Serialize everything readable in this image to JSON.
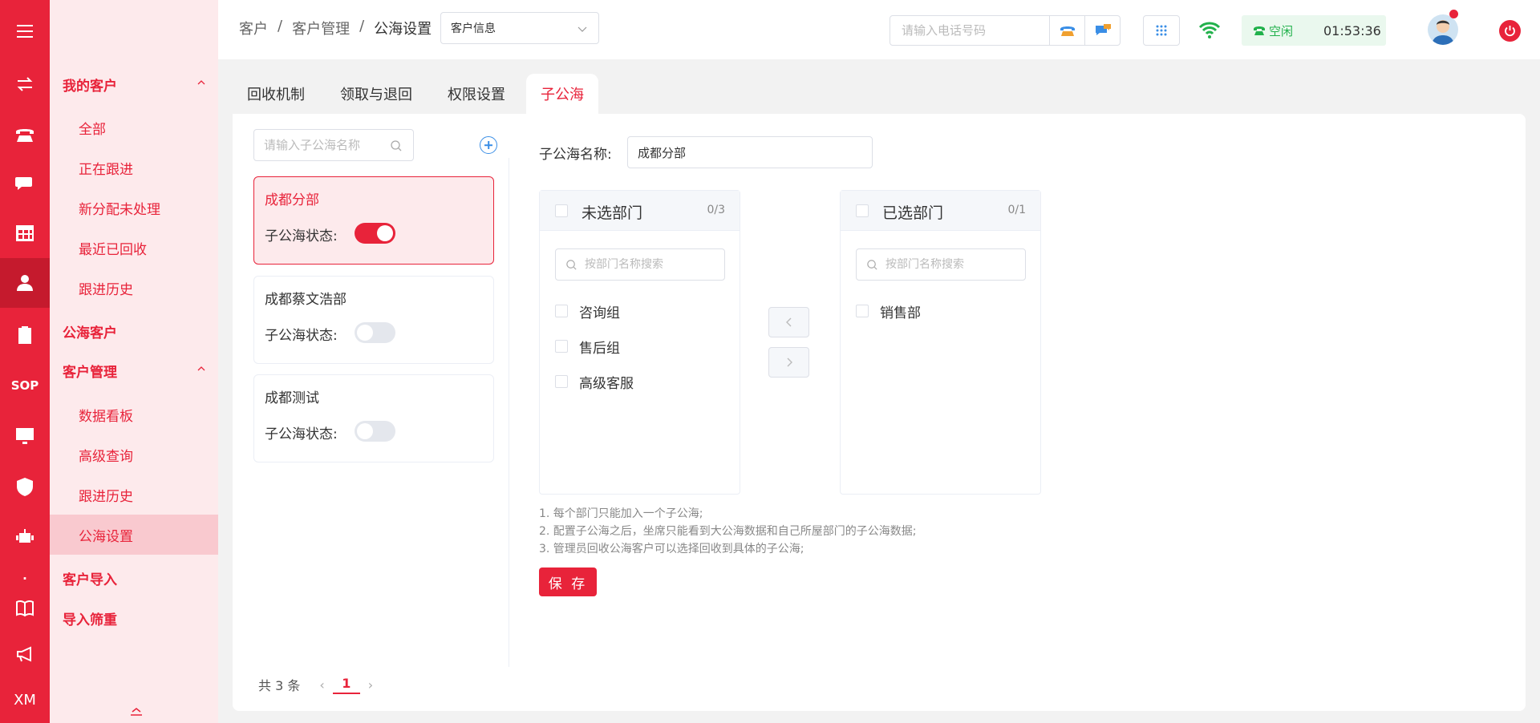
{
  "rail": {
    "icons": [
      "menu-icon",
      "swap-icon",
      "phone-icon",
      "chat-icon",
      "table-icon",
      "user-icon",
      "clipboard-icon",
      "sop-icon",
      "monitor-icon",
      "shield-icon",
      "robot-icon",
      "dot-icon",
      "book-icon",
      "megaphone-icon",
      "xm-icon"
    ],
    "sop_label": "SOP",
    "xm_label": "XM",
    "dot_label": "·"
  },
  "sidebar": {
    "group_my_customers": "我的客户",
    "item_all": "全部",
    "item_following": "正在跟进",
    "item_new_unprocessed": "新分配未处理",
    "item_recently_recycled": "最近已回收",
    "item_follow_history_1": "跟进历史",
    "group_public_sea": "公海客户",
    "group_customer_mgmt": "客户管理",
    "item_dashboard": "数据看板",
    "item_advanced_query": "高级查询",
    "item_follow_history_2": "跟进历史",
    "item_sea_settings": "公海设置",
    "group_import": "客户导入",
    "group_dedupe": "导入筛重"
  },
  "topbar": {
    "breadcrumb": [
      "客户",
      "客户管理",
      "公海设置"
    ],
    "breadcrumb_sep": "/",
    "select_value": "客户信息",
    "phone_placeholder": "请输入电话号码",
    "status_label": "空闲",
    "timer": "01:53:36",
    "accent": "#e8233a",
    "status_color": "#22b14c"
  },
  "tabs": [
    "回收机制",
    "领取与退回",
    "权限设置",
    "子公海"
  ],
  "active_tab": 3,
  "subsea": {
    "search_placeholder": "请输入子公海名称",
    "status_label": "子公海状态:",
    "cards": [
      {
        "name": "成都分部",
        "enabled": true,
        "selected": true
      },
      {
        "name": "成都蔡文浩部",
        "enabled": false,
        "selected": false
      },
      {
        "name": "成都测试",
        "enabled": false,
        "selected": false
      }
    ],
    "pager": {
      "total_text": "共 3 条",
      "current_page": "1",
      "prev": "‹",
      "next": "›"
    }
  },
  "form": {
    "name_label": "子公海名称:",
    "name_value": "成都分部",
    "left_panel": {
      "title": "未选部门",
      "count": "0/3",
      "search_placeholder": "按部门名称搜索",
      "items": [
        "咨询组",
        "售后组",
        "高级客服"
      ]
    },
    "right_panel": {
      "title": "已选部门",
      "count": "0/1",
      "search_placeholder": "按部门名称搜索",
      "items": [
        "销售部"
      ]
    },
    "notes": [
      "1. 每个部门只能加入一个子公海;",
      "2. 配置子公海之后，坐席只能看到大公海数据和自己所屋部门的子公海数据;",
      "3. 管理员回收公海客户可以选择回收到具体的子公海;"
    ],
    "save_label": "保 存"
  }
}
